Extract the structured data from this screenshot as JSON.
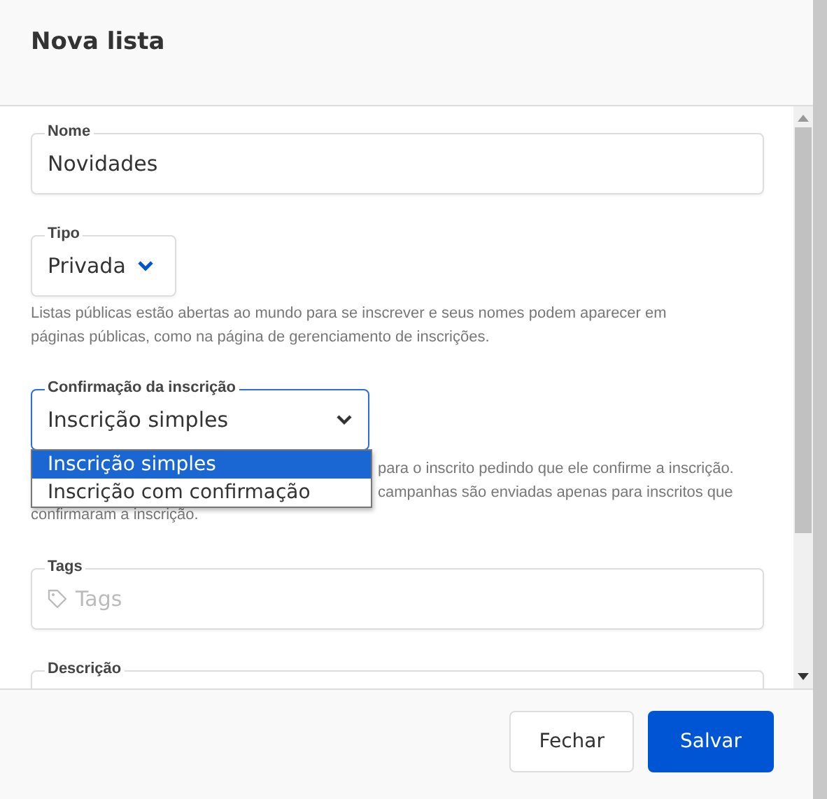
{
  "dialog": {
    "title": "Nova lista"
  },
  "fields": [
    {
      "kind": "text",
      "label": "Nome",
      "value": "Novidades"
    },
    {
      "kind": "select",
      "label": "Tipo",
      "value": "Privada",
      "help": [
        {
          "text": "Listas públicas estão abertas ao mundo para se inscrever e seus nomes podem aparecer em",
          "covered": false
        },
        {
          "text": "páginas públicas, como na página de gerenciamento de inscrições.",
          "covered": false
        }
      ]
    },
    {
      "kind": "select-open",
      "label": "Confirmação da inscrição",
      "value": "Inscrição simples",
      "options": [
        {
          "label": "Inscrição simples",
          "selected": true
        },
        {
          "label": "Inscrição com confirmação",
          "selected": false
        }
      ],
      "help": [
        {
          "text": "para o inscrito pedindo que ele confirme a inscrição.",
          "covered": true
        },
        {
          "text": "campanhas são enviadas apenas para inscritos que",
          "covered": true
        },
        {
          "text": "confirmaram a inscrição.",
          "covered": false
        }
      ]
    },
    {
      "kind": "tags",
      "label": "Tags",
      "placeholder": "Tags"
    },
    {
      "kind": "textarea",
      "label": "Descrição"
    }
  ],
  "buttons": [
    {
      "label": "Fechar",
      "kind": "secondary"
    },
    {
      "label": "Salvar",
      "kind": "primary"
    }
  ]
}
